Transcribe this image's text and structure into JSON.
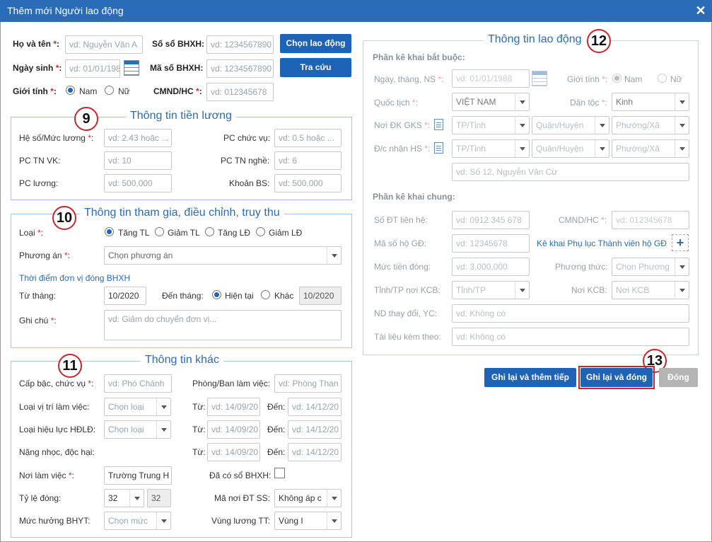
{
  "dialog": {
    "title": "Thêm mới Người lao động",
    "close": "✕"
  },
  "top": {
    "ho_ten_label": "Họ và tên",
    "ho_ten_ph": "vd: Nguyễn Văn A",
    "so_so_label": "Số sổ BHXH:",
    "so_so_ph": "vd: 1234567890",
    "chon_btn": "Chọn lao động",
    "ngay_sinh_label": "Ngày sinh",
    "ngay_sinh_ph": "vd: 01/01/1988",
    "ma_so_label": "Mã số BHXH:",
    "ma_so_ph": "vd: 1234567890",
    "tra_cuu_btn": "Tra cứu",
    "gioi_tinh_label": "Giới tính",
    "nam": "Nam",
    "nu": "Nữ",
    "cmnd_label": "CMND/HC",
    "cmnd_ph": "vd: 012345678"
  },
  "s9": {
    "num": "9",
    "title": "Thông tin tiền lương",
    "he_so_label": "Hệ số/Mức lương",
    "he_so_ph": "vd: 2.43 hoặc ...",
    "pc_chuc_vu_label": "PC chức vụ:",
    "pc_chuc_vu_ph": "vd: 0.5 hoặc ...",
    "pc_tnvk_label": "PC TN VK:",
    "pc_tnvk_ph": "vd: 10",
    "pc_tnn_label": "PC TN nghề:",
    "pc_tnn_ph": "vd: 6",
    "pc_luong_label": "PC lương:",
    "pc_luong_ph": "vd: 500,000",
    "khoan_bs_label": "Khoản BS:",
    "khoan_bs_ph": "vd: 500,000"
  },
  "s10": {
    "num": "10",
    "title": "Thông tin tham gia, điều chỉnh, truy thu",
    "loai_label": "Loại",
    "opts": [
      "Tăng TL",
      "Giảm TL",
      "Tăng LĐ",
      "Giảm LĐ"
    ],
    "phuong_an_label": "Phương án",
    "phuong_an_ph": "Chọn phương án",
    "thoi_diem": "Thời điểm đơn vị đóng BHXH",
    "tu_thang_label": "Từ tháng:",
    "tu_thang_val": "10/2020",
    "den_thang_label": "Đến tháng:",
    "hien_tai": "Hiện tại",
    "khac": "Khác",
    "khac_val": "10/2020",
    "ghi_chu_label": "Ghi chú",
    "ghi_chu_ph": "vd: Giảm do chuyển đơn vị..."
  },
  "s11": {
    "num": "11",
    "title": "Thông tin khác",
    "cap_bac_label": "Cấp bậc, chức vụ",
    "cap_bac_ph": "vd: Phó Chánh",
    "phong_ban_label": "Phòng/Ban làm việc:",
    "phong_ban_ph": "vd: Phòng Than",
    "loai_vt_label": "Loại vị trí làm việc:",
    "chon_loai": "Chọn loại",
    "tu": "Từ:",
    "den": "Đến:",
    "tu_ph": "vd: 14/09/20",
    "den_ph": "vd: 14/12/20",
    "loai_hl_label": "Loại hiệu lực HĐLĐ:",
    "nang_nhoc_label": "Nặng nhọc, độc hại:",
    "noi_lam_viec_label": "Nơi làm việc",
    "noi_lam_viec_val": "Trường Trung H",
    "da_co_so_label": "Đã có sổ BHXH:",
    "ty_le_label": "Tỷ lệ đóng:",
    "ty_le_val": "32",
    "ty_le_ro": "32",
    "ma_noi_label": "Mã nơi ĐT SS:",
    "ma_noi_val": "Không áp c",
    "muc_huong_label": "Mức hưởng BHYT:",
    "muc_huong_ph": "Chọn mức",
    "vung_luong_label": "Vùng lương TT:",
    "vung_luong_val": "Vùng I"
  },
  "s12": {
    "num": "12",
    "title": "Thông tin lao động",
    "bat_buoc": "Phần kê khai bắt buộc:",
    "ngay_ns_label": "Ngày, tháng, NS",
    "ngay_ns_ph": "vd: 01/01/1988",
    "gioi_tinh_label": "Giới tính",
    "nam": "Nam",
    "nu": "Nữ",
    "quoc_tich_label": "Quốc tịch",
    "quoc_tich_val": "VIỆT NAM",
    "dan_toc_label": "Dân tộc",
    "dan_toc_val": "Kinh",
    "noi_dk_label": "Nơi ĐK GKS",
    "dc_nhan_label": "Đ/c nhận HS",
    "tinh": "TP/Tỉnh",
    "quan": "Quận/Huyện",
    "phuong": "Phường/Xã",
    "dia_chi_ph": "vd: Số 12, Nguyễn Văn Cừ",
    "chung": "Phần kê khai chung:",
    "so_dt_label": "Số ĐT liên hệ:",
    "so_dt_ph": "vd: 0912 345 678",
    "cmnd_label": "CMND/HC",
    "cmnd_ph": "vd: 012345678",
    "ma_ho_label": "Mã số hộ GĐ:",
    "ma_ho_ph": "vd: 12345678",
    "ke_khai_link": "Kê khai Phụ lục Thành viên hộ GĐ",
    "plus": "+",
    "muc_tien_label": "Mức tiền đóng:",
    "muc_tien_ph": "vd: 3,000,000",
    "phuong_thuc_label": "Phương thức:",
    "phuong_thuc_ph": "Chọn Phương",
    "tinh_kcb_label": "Tỉnh/TP nơi KCB:",
    "tinh_kcb_ph": "Tỉnh/TP",
    "noi_kcb_label": "Nơi KCB:",
    "noi_kcb_ph": "Nơi KCB",
    "nd_label": "ND thay đổi, YC:",
    "nd_ph": "vd: Không có",
    "tai_lieu_label": "Tài liệu kèm theo:",
    "tai_lieu_ph": "vd: Không có"
  },
  "footer": {
    "num": "13",
    "ghi_lai_them": "Ghi lại và thêm tiếp",
    "ghi_lai_dong": "Ghi lại và đóng",
    "dong": "Đóng"
  },
  "colors": {
    "header": "#2a6cb7",
    "button": "#1e63b5",
    "highlight": "#c9252b"
  }
}
